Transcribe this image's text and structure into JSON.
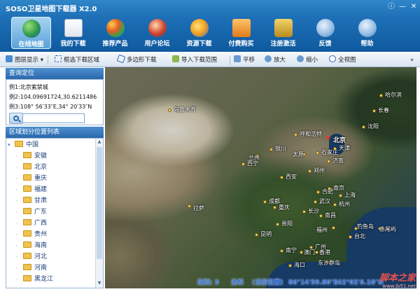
{
  "window": {
    "title": "SOSO卫星地图下载器 X2.0",
    "controls": [
      "info-icon",
      "minimize-icon",
      "close-icon"
    ]
  },
  "toolbar": {
    "items": [
      {
        "label": "在线地图",
        "icon": "globe-icon",
        "active": true
      },
      {
        "label": "我的下载",
        "icon": "document-list-icon"
      },
      {
        "label": "推荐产品",
        "icon": "products-icon"
      },
      {
        "label": "用户论坛",
        "icon": "users-icon"
      },
      {
        "label": "资源下载",
        "icon": "download-icon"
      },
      {
        "label": "付费购买",
        "icon": "cart-icon"
      },
      {
        "label": "注册激活",
        "icon": "lock-key-icon"
      },
      {
        "label": "反馈",
        "icon": "info-circle-icon"
      },
      {
        "label": "帮助",
        "icon": "help-circle-icon"
      }
    ]
  },
  "subbar": {
    "items": [
      {
        "label": "图层显示 ▾",
        "icon": "layers-icon"
      },
      {
        "label": "框选下载区域",
        "icon": "select-rect-icon"
      },
      {
        "label": "多边形下载",
        "icon": "polygon-icon"
      },
      {
        "label": "导入下载范围",
        "icon": "import-icon"
      },
      {
        "label": "平移",
        "icon": "pan-icon"
      },
      {
        "label": "放大",
        "icon": "zoom-in-icon"
      },
      {
        "label": "缩小",
        "icon": "zoom-out-icon"
      },
      {
        "label": "全视图",
        "icon": "full-view-icon"
      }
    ],
    "more": "»"
  },
  "locate": {
    "header": "查询定位",
    "example1": "例1:北京紫禁城",
    "example2": "例2:104.09691724,30.6211486",
    "example3": "例3:108° 56′33″E,34° 20′33″N",
    "input_value": "",
    "placeholder": ""
  },
  "regions": {
    "header": "区域划分位置列表",
    "root": "中国",
    "children": [
      "安徽",
      "北京",
      "重庆",
      "福建",
      "甘肃",
      "广东",
      "广西",
      "贵州",
      "海南",
      "河北",
      "河南",
      "黑龙江"
    ]
  },
  "map": {
    "cities": [
      {
        "name": "乌鲁木齐"
      },
      {
        "name": "呼和浩特"
      },
      {
        "name": "北京"
      },
      {
        "name": "哈尔滨"
      },
      {
        "name": "长春"
      },
      {
        "name": "沈阳"
      },
      {
        "name": "银川"
      },
      {
        "name": "太原"
      },
      {
        "name": "石家庄"
      },
      {
        "name": "天津"
      },
      {
        "name": "西宁"
      },
      {
        "name": "兰州"
      },
      {
        "name": "济南"
      },
      {
        "name": "郑州"
      },
      {
        "name": "西安"
      },
      {
        "name": "合肥"
      },
      {
        "name": "南京"
      },
      {
        "name": "武汉"
      },
      {
        "name": "杭州"
      },
      {
        "name": "上海"
      },
      {
        "name": "成都"
      },
      {
        "name": "重庆"
      },
      {
        "name": "拉萨"
      },
      {
        "name": "长沙"
      },
      {
        "name": "南昌"
      },
      {
        "name": "贵阳"
      },
      {
        "name": "福州"
      },
      {
        "name": "昆明"
      },
      {
        "name": "广州"
      },
      {
        "name": "钓鱼岛"
      },
      {
        "name": "赤尾屿"
      },
      {
        "name": "南宁"
      },
      {
        "name": "澳门"
      },
      {
        "name": "香港"
      },
      {
        "name": "台北"
      },
      {
        "name": "东沙群岛"
      },
      {
        "name": "海口"
      }
    ],
    "capital_name": "北京"
  },
  "status": {
    "level_label": "级别: 5",
    "coord_label": "坐标",
    "coord_note": "(当前位置)",
    "lon": "86°14′59.80″E",
    "lat": "42°02′6.10″N"
  },
  "watermark": {
    "text": "脚本之家",
    "url": "www.jb51.net"
  },
  "colors": {
    "title_blue": "#1d6fb6",
    "active_tab": "#7fbbe8",
    "panel_header": "#2a68ad",
    "capital_star": "#ff2a2a",
    "status_text": "#2a6ad8"
  }
}
